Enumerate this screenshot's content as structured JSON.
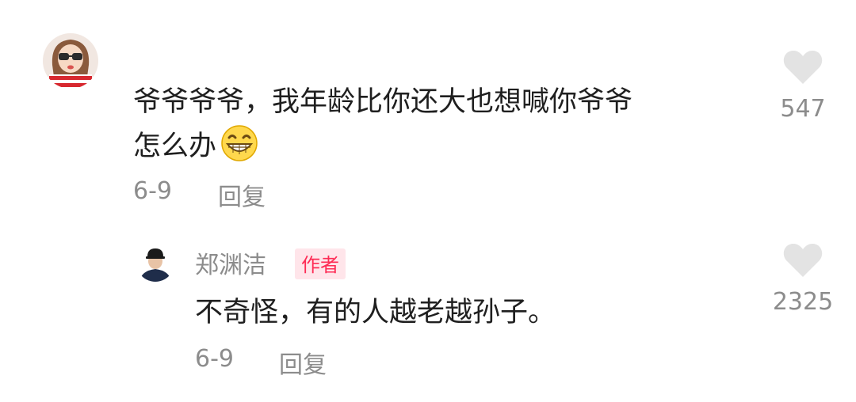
{
  "comment": {
    "text_line1": "爷爷爷爷，我年龄比你还大也想喊你爷爷",
    "text_line2": "怎么办",
    "emoji": "grinning-face-emoji",
    "date": "6-9",
    "reply_label": "回复",
    "like_icon": "heart-icon",
    "like_count": "547"
  },
  "reply": {
    "username": "郑渊洁",
    "author_badge": "作者",
    "text": "不奇怪，有的人越老越孙子。",
    "date": "6-9",
    "reply_label": "回复",
    "like_icon": "heart-icon",
    "like_count": "2325"
  },
  "colors": {
    "badge_bg": "#ffe5ea",
    "badge_text": "#fe2c55",
    "meta_text": "#8c8c8c",
    "body_text": "#1f1f1f",
    "heart": "#e3e3e3"
  }
}
